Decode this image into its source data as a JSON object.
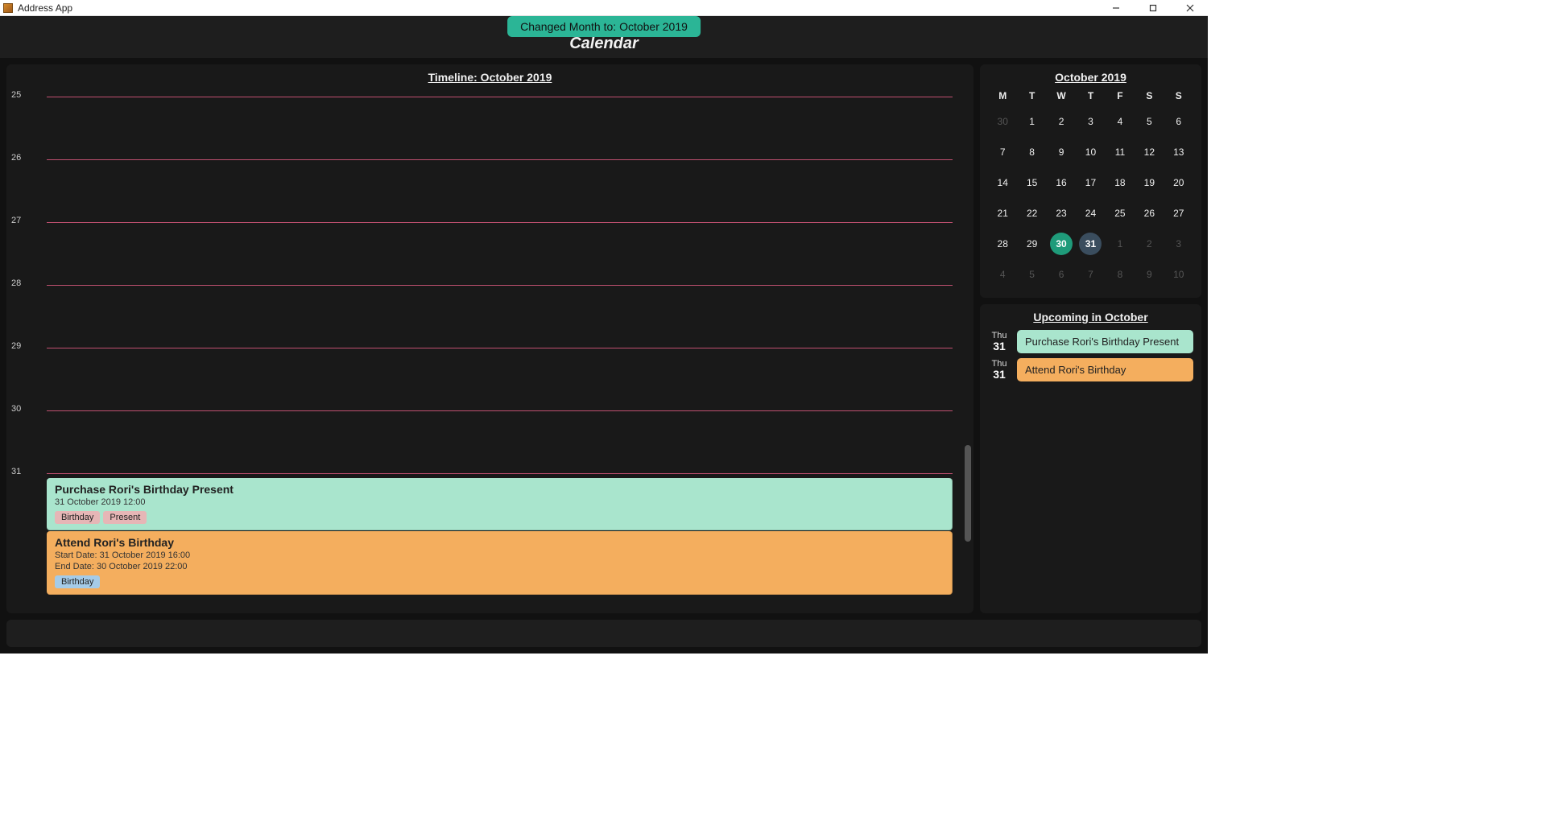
{
  "window": {
    "title": "Address App"
  },
  "toast": "Changed Month to: October 2019",
  "header": {
    "title": "Calendar"
  },
  "timeline": {
    "title": "Timeline: October 2019",
    "visible_days": [
      "25",
      "26",
      "27",
      "28",
      "29",
      "30",
      "31"
    ],
    "events": [
      {
        "title": "Purchase Rori's Birthday Present",
        "time_line": "31 October 2019 12:00",
        "tags": [
          {
            "label": "Birthday",
            "style": "pink"
          },
          {
            "label": "Present",
            "style": "pink"
          }
        ],
        "color": "green"
      },
      {
        "title": "Attend Rori's Birthday",
        "start_line": "Start Date: 31 October 2019 16:00",
        "end_line": "End Date: 30 October 2019 22:00",
        "tags": [
          {
            "label": "Birthday",
            "style": "blue"
          }
        ],
        "color": "orange"
      }
    ]
  },
  "mini_calendar": {
    "title": "October 2019",
    "dow": [
      "M",
      "T",
      "W",
      "T",
      "F",
      "S",
      "S"
    ],
    "weeks": [
      [
        {
          "n": "30",
          "dim": true
        },
        {
          "n": "1"
        },
        {
          "n": "2"
        },
        {
          "n": "3"
        },
        {
          "n": "4"
        },
        {
          "n": "5"
        },
        {
          "n": "6"
        }
      ],
      [
        {
          "n": "7"
        },
        {
          "n": "8"
        },
        {
          "n": "9"
        },
        {
          "n": "10"
        },
        {
          "n": "11"
        },
        {
          "n": "12"
        },
        {
          "n": "13"
        }
      ],
      [
        {
          "n": "14"
        },
        {
          "n": "15"
        },
        {
          "n": "16"
        },
        {
          "n": "17"
        },
        {
          "n": "18"
        },
        {
          "n": "19"
        },
        {
          "n": "20"
        }
      ],
      [
        {
          "n": "21"
        },
        {
          "n": "22"
        },
        {
          "n": "23"
        },
        {
          "n": "24"
        },
        {
          "n": "25"
        },
        {
          "n": "26"
        },
        {
          "n": "27"
        }
      ],
      [
        {
          "n": "28"
        },
        {
          "n": "29"
        },
        {
          "n": "30",
          "today": true
        },
        {
          "n": "31",
          "selected": true
        },
        {
          "n": "1",
          "dim": true
        },
        {
          "n": "2",
          "dim": true
        },
        {
          "n": "3",
          "dim": true
        }
      ],
      [
        {
          "n": "4",
          "dim": true
        },
        {
          "n": "5",
          "dim": true
        },
        {
          "n": "6",
          "dim": true
        },
        {
          "n": "7",
          "dim": true
        },
        {
          "n": "8",
          "dim": true
        },
        {
          "n": "9",
          "dim": true
        },
        {
          "n": "10",
          "dim": true
        }
      ]
    ]
  },
  "upcoming": {
    "title": "Upcoming in October",
    "items": [
      {
        "dow": "Thu",
        "day": "31",
        "label": "Purchase Rori's Birthday Present",
        "color": "green"
      },
      {
        "dow": "Thu",
        "day": "31",
        "label": "Attend Rori's Birthday",
        "color": "orange"
      }
    ]
  }
}
